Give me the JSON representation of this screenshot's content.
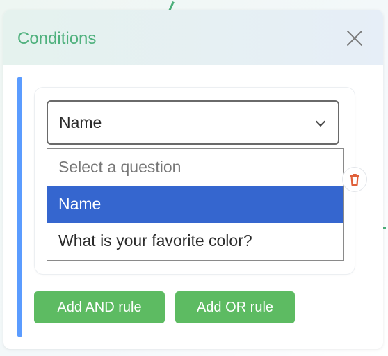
{
  "modal": {
    "title": "Conditions",
    "close_icon": "close-icon"
  },
  "colors": {
    "title": "#4fb17d",
    "group_bar": "#5b9cff",
    "selected_option": "#3566cf",
    "button_bg": "#5dbb62",
    "delete_icon": "#e0603a"
  },
  "rule": {
    "select": {
      "value": "Name",
      "icon": "chevron-down-icon",
      "options": [
        {
          "label": "Select a question",
          "state": "placeholder"
        },
        {
          "label": "Name",
          "state": "selected"
        },
        {
          "label": "What is your favorite color?",
          "state": "normal"
        }
      ]
    },
    "delete_icon": "trash-icon"
  },
  "actions": {
    "add_and_label": "Add AND rule",
    "add_or_label": "Add OR rule"
  }
}
